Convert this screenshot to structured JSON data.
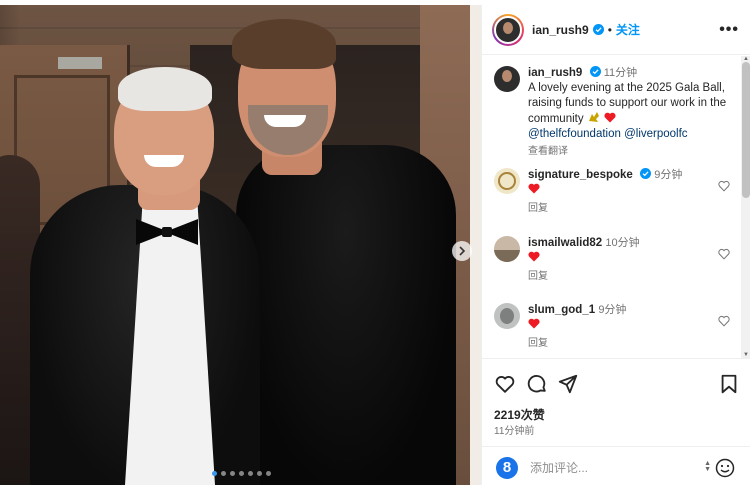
{
  "post": {
    "username": "ian_rush9",
    "follow_label": "关注",
    "separator": "•",
    "more_label": "•••"
  },
  "caption": {
    "username": "ian_rush9",
    "time": "11分钟",
    "text": "A lovely evening at the 2025 Gala Ball, raising funds to support our work in the community",
    "mention_1": "@thelfcfoundation",
    "mention_2": "@liverpoolfc",
    "translate_label": "查看翻译"
  },
  "comments": [
    {
      "username": "signature_bespoke",
      "time": "9分钟",
      "reply_label": "回复"
    },
    {
      "username": "ismailwalid82",
      "time": "10分钟",
      "reply_label": "回复"
    },
    {
      "username": "slum_god_1",
      "time": "9分钟",
      "reply_label": "回复"
    }
  ],
  "stats": {
    "likes": "2219次赞",
    "posted": "11分钟前"
  },
  "composer": {
    "badge": "8",
    "placeholder": "添加评论..."
  },
  "carousel": {
    "total": 7,
    "active": 1
  },
  "colors": {
    "accent": "#0095f6",
    "heart": "#ed4956",
    "verified": "#0095f6"
  },
  "icons": [
    "verified-icon",
    "more-icon",
    "heart-icon",
    "comment-icon",
    "share-icon",
    "save-icon",
    "emoji-icon",
    "chevron-right-icon"
  ]
}
